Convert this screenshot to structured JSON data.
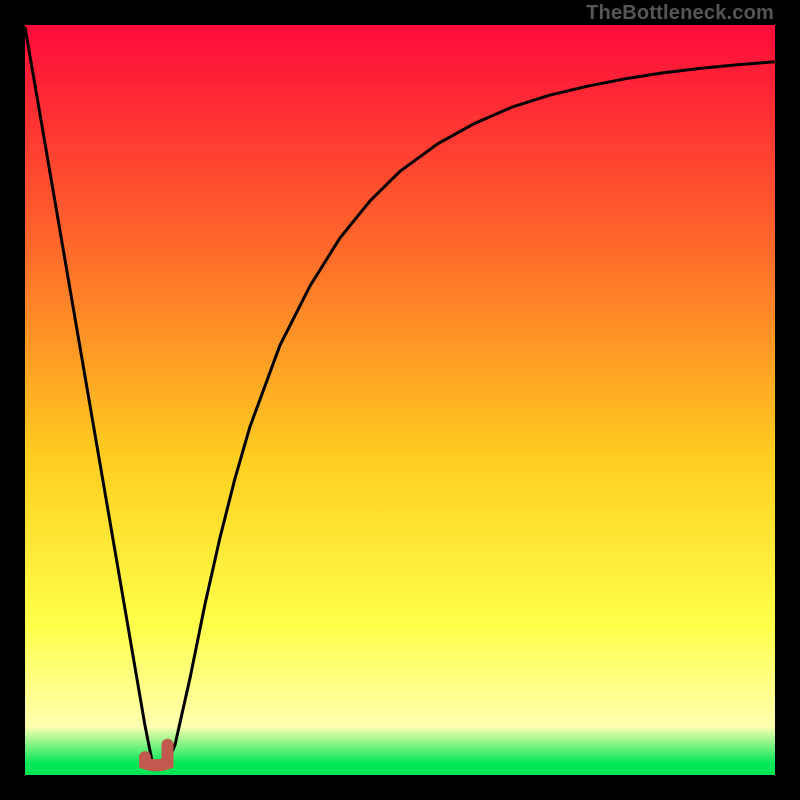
{
  "watermark": "TheBottleneck.com",
  "colors": {
    "frame": "#000000",
    "gradient_top": "#ff0a3a",
    "gradient_mid1": "#ff6a2a",
    "gradient_mid2": "#ffcf20",
    "gradient_mid3": "#ffff4a",
    "gradient_pale": "#ffffb0",
    "gradient_green": "#00e756",
    "curve": "#000000",
    "marker": "#c1594f"
  },
  "chart_data": {
    "type": "line",
    "title": "",
    "xlabel": "",
    "ylabel": "",
    "xlim": [
      0,
      100
    ],
    "ylim": [
      0,
      100
    ],
    "x": [
      0,
      2,
      4,
      6,
      8,
      10,
      12,
      14,
      16,
      17,
      18,
      19,
      20,
      22,
      24,
      26,
      28,
      30,
      34,
      38,
      42,
      46,
      50,
      55,
      60,
      65,
      70,
      75,
      80,
      85,
      90,
      95,
      100
    ],
    "values": [
      100,
      88.2,
      76.4,
      64.6,
      52.8,
      41.0,
      29.2,
      17.4,
      5.6,
      0.5,
      0.5,
      0.5,
      3.0,
      12.0,
      22.0,
      31.0,
      39.0,
      46.0,
      57.0,
      65.0,
      71.5,
      76.5,
      80.5,
      84.2,
      87.0,
      89.2,
      90.8,
      92.0,
      93.0,
      93.8,
      94.4,
      94.9,
      95.3
    ],
    "minimum_marker": {
      "x_range": [
        16.0,
        19.0
      ],
      "y": 0.5
    }
  }
}
